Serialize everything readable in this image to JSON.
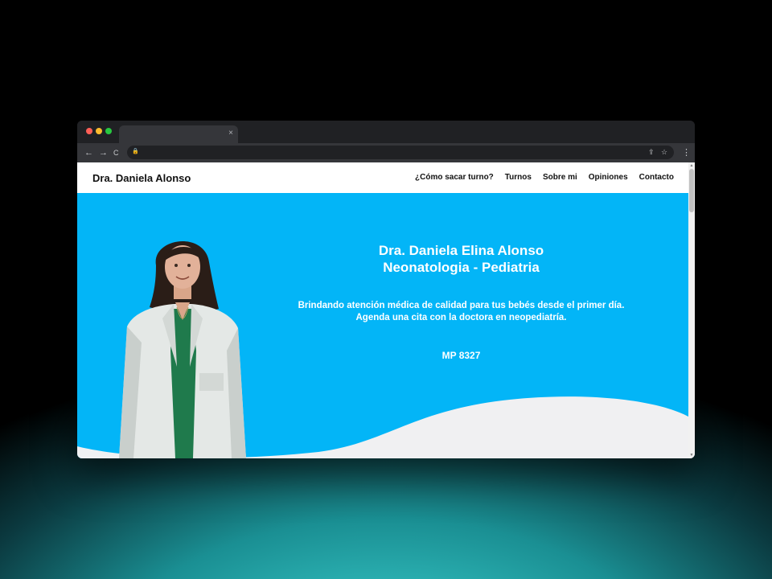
{
  "browser": {
    "tab_close": "×",
    "toolbar": {
      "back": "←",
      "forward": "→",
      "reload": "C"
    },
    "omnibox": {
      "lock": "🔒",
      "share": "⇪",
      "star": "☆",
      "menu": "⋮"
    }
  },
  "site": {
    "brand": "Dra. Daniela Alonso",
    "nav": [
      "¿Cómo sacar turno?",
      "Turnos",
      "Sobre mi",
      "Opiniones",
      "Contacto"
    ]
  },
  "hero": {
    "title_line1": "Dra. Daniela Elina Alonso",
    "title_line2": "Neonatologia - Pediatria",
    "subtitle_line1": "Brindando atención médica de calidad para tus bebés desde el primer día.",
    "subtitle_line2": "Agenda una cita con la doctora en neopediatría.",
    "license": "MP 8327"
  },
  "colors": {
    "hero_bg": "#03b5f7",
    "wave": "#f0f0f2",
    "coat": "#e4e8e6",
    "blouse": "#1f7a4c",
    "hair": "#2a1d17"
  },
  "icons": {
    "traffic_lights": [
      "close-dot",
      "minimize-dot",
      "zoom-dot"
    ],
    "doctor_photo": "doctor-portrait-image"
  }
}
